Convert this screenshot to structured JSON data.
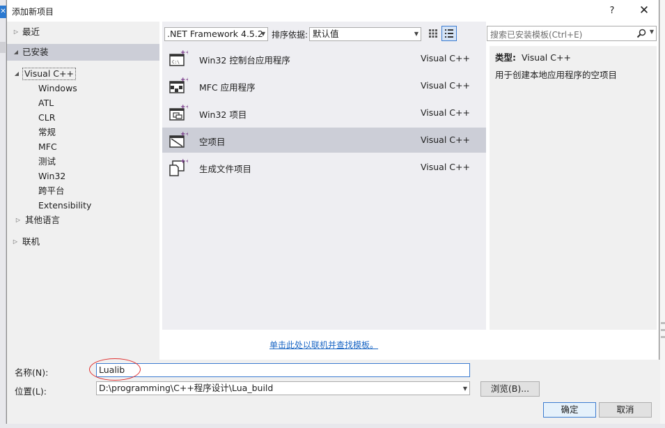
{
  "window": {
    "title": "添加新项目",
    "help": "?",
    "close": "✕"
  },
  "tree": {
    "recent": "最近",
    "installed": "已安装",
    "visual_cpp": "Visual C++",
    "children": [
      "Windows",
      "ATL",
      "CLR",
      "常规",
      "MFC",
      "测试",
      "Win32",
      "跨平台",
      "Extensibility"
    ],
    "other_languages": "其他语言",
    "online": "联机"
  },
  "toolbar": {
    "framework": ".NET Framework 4.5.2",
    "sort_label": "排序依据:",
    "sort_value": "默认值"
  },
  "templates": [
    {
      "name": "Win32 控制台应用程序",
      "lang": "Visual C++",
      "icon": "console-app-icon",
      "selected": false
    },
    {
      "name": "MFC 应用程序",
      "lang": "Visual C++",
      "icon": "mfc-app-icon",
      "selected": false
    },
    {
      "name": "Win32 项目",
      "lang": "Visual C++",
      "icon": "win32-project-icon",
      "selected": false
    },
    {
      "name": "空项目",
      "lang": "Visual C++",
      "icon": "empty-project-icon",
      "selected": true
    },
    {
      "name": "生成文件项目",
      "lang": "Visual C++",
      "icon": "makefile-project-icon",
      "selected": false
    }
  ],
  "online_link": "单击此处以联机并查找模板。",
  "search": {
    "placeholder": "搜索已安装模板(Ctrl+E)"
  },
  "details": {
    "type_key": "类型:",
    "type_value": "Visual C++",
    "description": "用于创建本地应用程序的空项目"
  },
  "form": {
    "name_label": "名称(N):",
    "name_value": "Lualib",
    "location_label": "位置(L):",
    "location_value": "D:\\programming\\C++程序设计\\Lua_build",
    "browse": "浏览(B)...",
    "ok": "确定",
    "cancel": "取消"
  },
  "colors": {
    "accent": "#3b7bd0",
    "selection": "#ccced7",
    "annotation": "#e03030"
  }
}
